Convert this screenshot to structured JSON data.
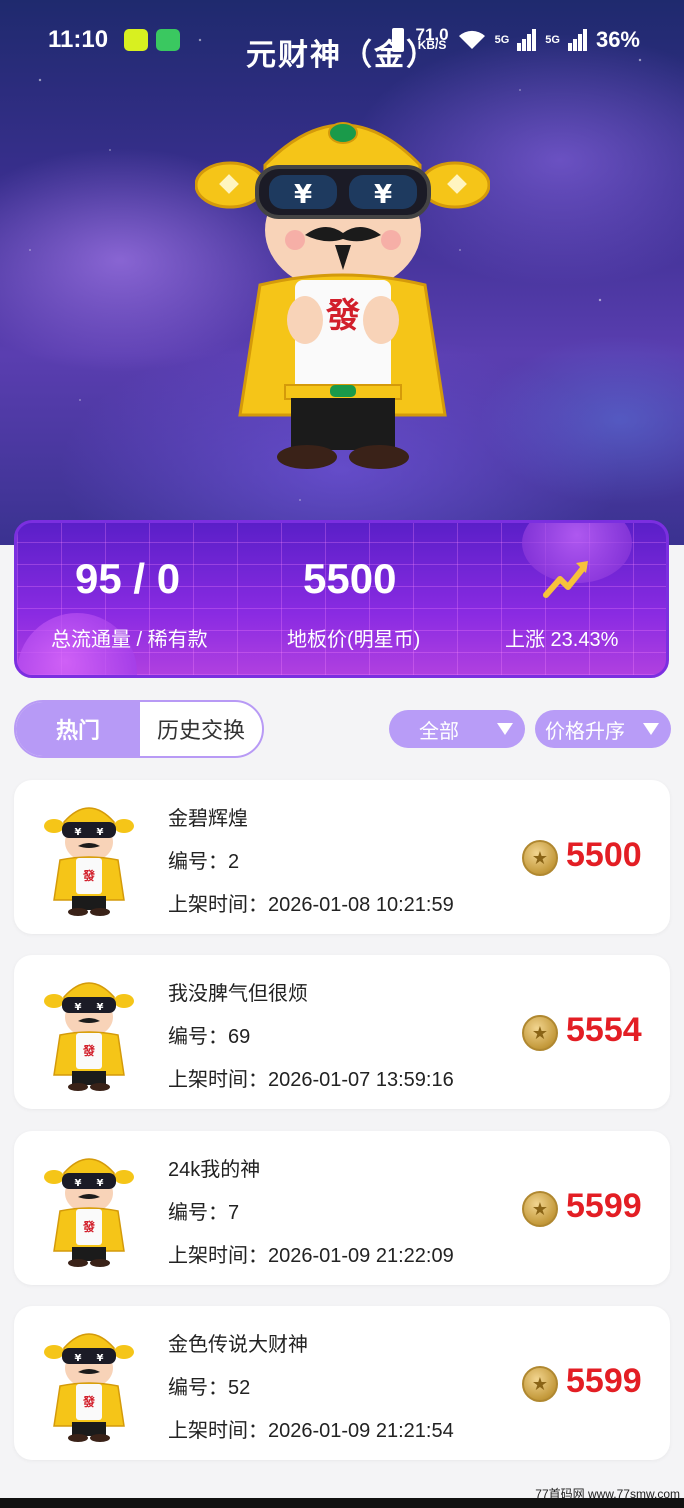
{
  "status_bar": {
    "time": "11:10",
    "net_speed_value": "71.0",
    "net_speed_unit": "KB/S",
    "sig1": "5G",
    "sig2": "5G",
    "battery": "36%"
  },
  "page_title": "元财神（金）",
  "stats": {
    "circulation_value": "95 / 0",
    "circulation_label": "总流通量 / 稀有款",
    "floor_price_value": "5500",
    "floor_price_label": "地板价(明星币)",
    "rise_label": "上涨 23.43%"
  },
  "tabs": {
    "hot": "热门",
    "history": "历史交换"
  },
  "filters": {
    "category": "全部",
    "sort": "价格升序"
  },
  "listings": [
    {
      "name": "金碧辉煌",
      "id_text": "编号：2",
      "time_text": "上架时间：2026-01-08 10:21:59",
      "price": "5500"
    },
    {
      "name": "我没脾气但很烦",
      "id_text": "编号：69",
      "time_text": "上架时间：2026-01-07 13:59:16",
      "price": "5554"
    },
    {
      "name": "24k我的神",
      "id_text": "编号：7",
      "time_text": "上架时间：2026-01-09 21:22:09",
      "price": "5599"
    },
    {
      "name": "金色传说大财神",
      "id_text": "编号：52",
      "time_text": "上架时间：2026-01-09 21:21:54",
      "price": "5599"
    }
  ],
  "watermark": "77首码网 www.77smw.com",
  "colors": {
    "accent_purple": "#b89cf7",
    "price_red": "#e31e24",
    "gold": "#f5c518"
  }
}
